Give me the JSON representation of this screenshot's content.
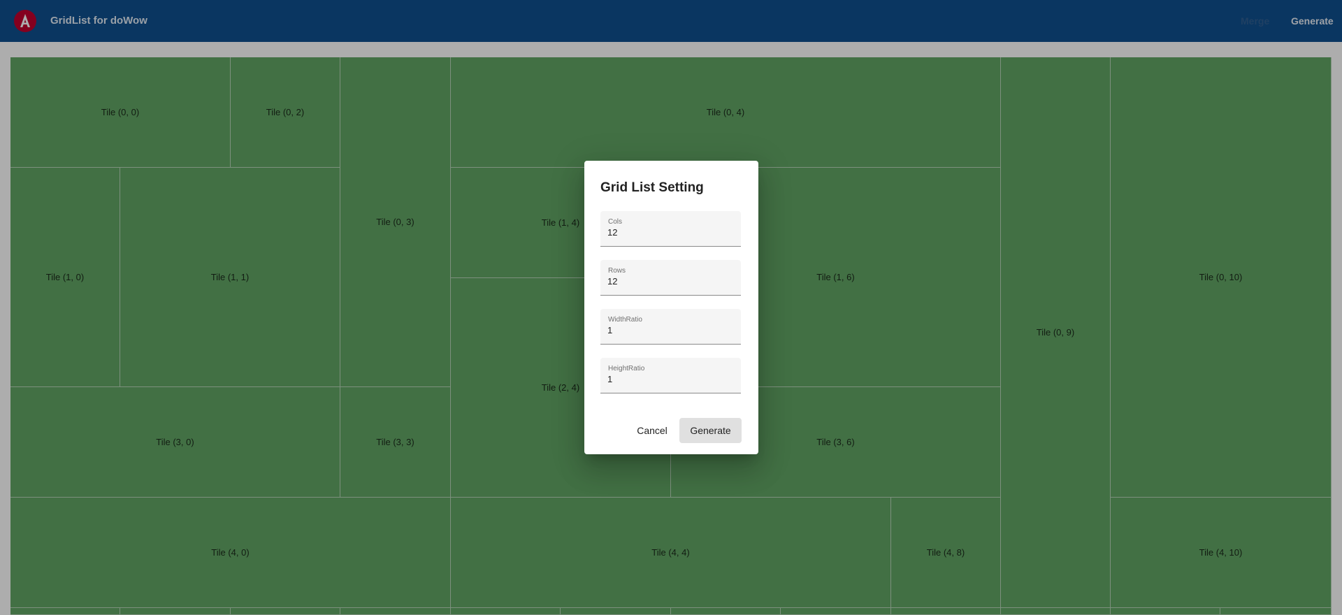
{
  "toolbar": {
    "title": "GridList for doWow",
    "merge_label": "Merge",
    "generate_label": "Generate",
    "color": "#0f5090"
  },
  "grid": {
    "tile_color": "#62a665",
    "tiles": [
      {
        "label": "Tile (0, 0)"
      },
      {
        "label": "Tile (0, 2)"
      },
      {
        "label": "Tile (0, 3)"
      },
      {
        "label": "Tile (0, 4)"
      },
      {
        "label": "Tile (0, 9)"
      },
      {
        "label": "Tile (0, 10)"
      },
      {
        "label": "Tile (1, 0)"
      },
      {
        "label": "Tile (1, 1)"
      },
      {
        "label": "Tile (1, 4)"
      },
      {
        "label": "Tile (1, 6)"
      },
      {
        "label": "Tile (2, 4)"
      },
      {
        "label": "Tile (3, 0)"
      },
      {
        "label": "Tile (3, 3)"
      },
      {
        "label": "Tile (3, 6)"
      },
      {
        "label": "Tile (4, 0)"
      },
      {
        "label": "Tile (4, 4)"
      },
      {
        "label": "Tile (4, 8)"
      },
      {
        "label": "Tile (4, 10)"
      },
      {
        "label": ""
      },
      {
        "label": ""
      },
      {
        "label": ""
      },
      {
        "label": ""
      },
      {
        "label": ""
      },
      {
        "label": ""
      },
      {
        "label": ""
      },
      {
        "label": ""
      },
      {
        "label": ""
      },
      {
        "label": ""
      },
      {
        "label": ""
      },
      {
        "label": ""
      }
    ]
  },
  "dialog": {
    "title": "Grid List Setting",
    "fields": [
      {
        "label": "Cols",
        "value": "12"
      },
      {
        "label": "Rows",
        "value": "12"
      },
      {
        "label": "WidthRatio",
        "value": "1"
      },
      {
        "label": "HeightRatio",
        "value": "1"
      }
    ],
    "cancel_label": "Cancel",
    "generate_label": "Generate"
  }
}
